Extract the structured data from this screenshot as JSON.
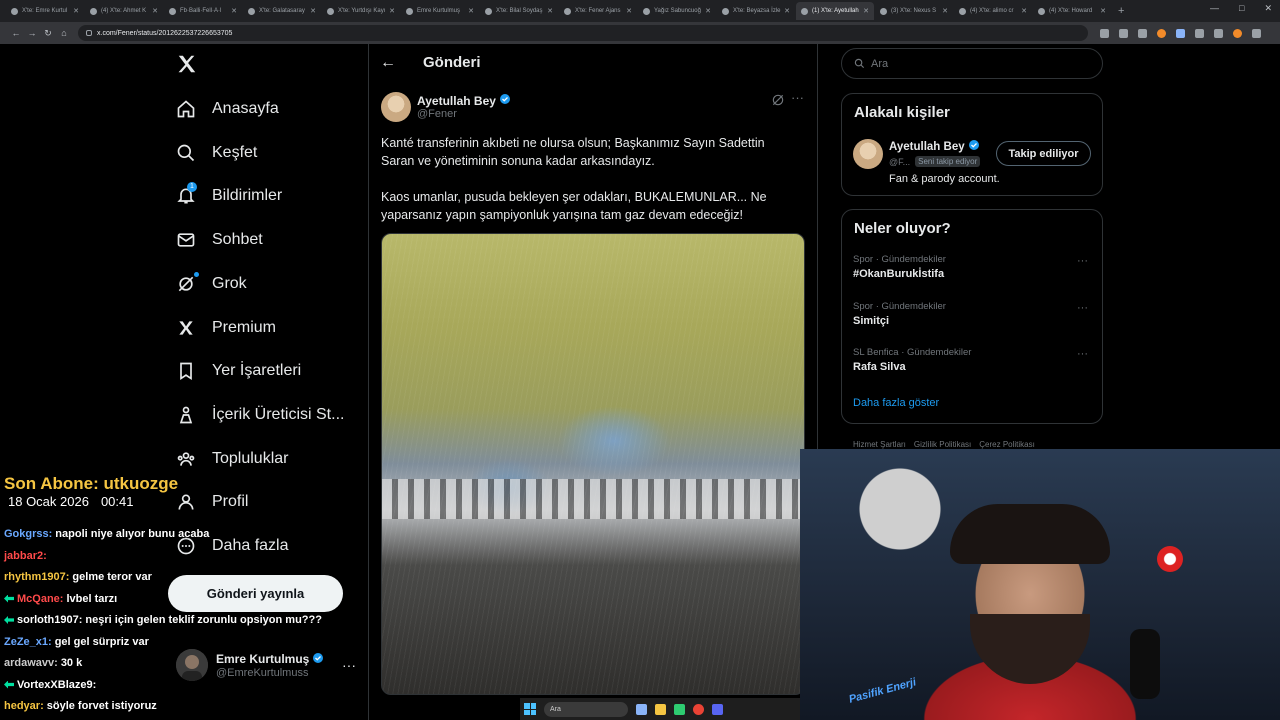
{
  "browser": {
    "tabs": [
      {
        "label": "X'te: Emre Kurtul"
      },
      {
        "label": "(4) X'te: Ahmet K"
      },
      {
        "label": "Fb·Balli·Fell·A·l"
      },
      {
        "label": "X'te: Galatasaray"
      },
      {
        "label": "X'te: Yurtdışı Kayı"
      },
      {
        "label": "Emre Kurtulmuş"
      },
      {
        "label": "X'te: Bilal Soydaş"
      },
      {
        "label": "X'te: Fener Ajans"
      },
      {
        "label": "Yağız Sabuncuoğ"
      },
      {
        "label": "X'te: Beyazsa İzle"
      },
      {
        "label": "(1) X'te: Ayetullah"
      },
      {
        "label": "(3) X'te: Nexus S"
      },
      {
        "label": "(4) X'te: alimo cr"
      },
      {
        "label": "(4) X'te: Howard"
      }
    ],
    "active_tab_index": 10,
    "url": "x.com/Fener/status/2012622537226653705"
  },
  "nav": {
    "items": [
      {
        "label": "Anasayfa",
        "icon": "home-icon"
      },
      {
        "label": "Keşfet",
        "icon": "search-icon"
      },
      {
        "label": "Bildirimler",
        "icon": "bell-icon"
      },
      {
        "label": "Sohbet",
        "icon": "mail-icon"
      },
      {
        "label": "Grok",
        "icon": "grok-icon"
      },
      {
        "label": "Premium",
        "icon": "x-premium-icon"
      },
      {
        "label": "Yer İşaretleri",
        "icon": "bookmark-icon"
      },
      {
        "label": "İçerik Üreticisi St...",
        "icon": "creator-studio-icon"
      },
      {
        "label": "Topluluklar",
        "icon": "communities-icon"
      },
      {
        "label": "Profil",
        "icon": "profile-icon"
      },
      {
        "label": "Daha fazla",
        "icon": "more-circle-icon"
      }
    ],
    "notification_count": "1",
    "post_button": "Gönderi yayınla",
    "account": {
      "name": "Emre Kurtulmuş",
      "handle": "@EmreKurtulmuss"
    }
  },
  "post": {
    "header": "Gönderi",
    "author_name": "Ayetullah Bey",
    "author_handle": "@Fener",
    "paragraph1": "Kanté transferinin akıbeti ne olursa olsun; Başkanımız Sayın Sadettin Saran ve yönetiminin sonuna kadar arkasındayız.",
    "paragraph2": "Kaos umanlar, pusuda bekleyen şer odakları, BUKALEMUNLAR... Ne yaparsanız yapın şampiyonluk yarışına tam gaz devam edeceğiz!"
  },
  "sidebar": {
    "search_placeholder": "Ara",
    "related_title": "Alakalı kişiler",
    "related": {
      "name": "Ayetullah Bey",
      "handle": "@F...",
      "follows_you": "Seni takip ediyor",
      "bio": "Fan & parody account.",
      "follow_button": "Takip ediliyor"
    },
    "trends_title": "Neler oluyor?",
    "trends": [
      {
        "category": "Spor · Gündemdekiler",
        "name": "#OkanBurukİstifa"
      },
      {
        "category": "Spor · Gündemdekiler",
        "name": "Simitçi"
      },
      {
        "category": "SL Benfica · Gündemdekiler",
        "name": "Rafa Silva"
      }
    ],
    "show_more": "Daha fazla göster",
    "footer": [
      "Hizmet Şartları",
      "Gizlilik Politikası",
      "Çerez Politikası"
    ]
  },
  "overlay": {
    "subscriber": "Son Abone: utkuozge",
    "date": "18 Ocak 2026",
    "time": "00:41",
    "chat": [
      {
        "user": "Gokgrss:",
        "msg": "napoli niye alıyor bunu acaba",
        "color": "#6aa8ff",
        "tag": false
      },
      {
        "user": "jabbar2:",
        "msg": "",
        "color": "#ff4a4a",
        "tag": false
      },
      {
        "user": "rhythm1907:",
        "msg": "gelme teror var",
        "color": "#f5c542",
        "tag": false
      },
      {
        "user": "McQane:",
        "msg": "lvbel tarzı",
        "color": "#ff4a4a",
        "tag": true
      },
      {
        "user": "sorloth1907:",
        "msg": "neşri için gelen teklif zorunlu opsiyon mu???",
        "color": "#ffffff",
        "tag": true
      },
      {
        "user": "ZeZe_x1:",
        "msg": "gel gel sürpriz var",
        "color": "#6aa8ff",
        "tag": false
      },
      {
        "user": "ardawavv:",
        "msg": "30 k",
        "color": "#cccccc",
        "tag": false
      },
      {
        "user": "VortexXBlaze9:",
        "msg": "",
        "color": "#ffffff",
        "tag": true
      },
      {
        "user": "hedyar:",
        "msg": "söyle forvet istiyoruz",
        "color": "#f5c542",
        "tag": false
      }
    ],
    "jersey_text": "Pasifik Enerji"
  },
  "taskbar": {
    "search_placeholder": "Ara"
  },
  "colors": {
    "accent": "#1d9bf0",
    "background": "#000000",
    "border": "#2f3336",
    "muted": "#71767b"
  }
}
